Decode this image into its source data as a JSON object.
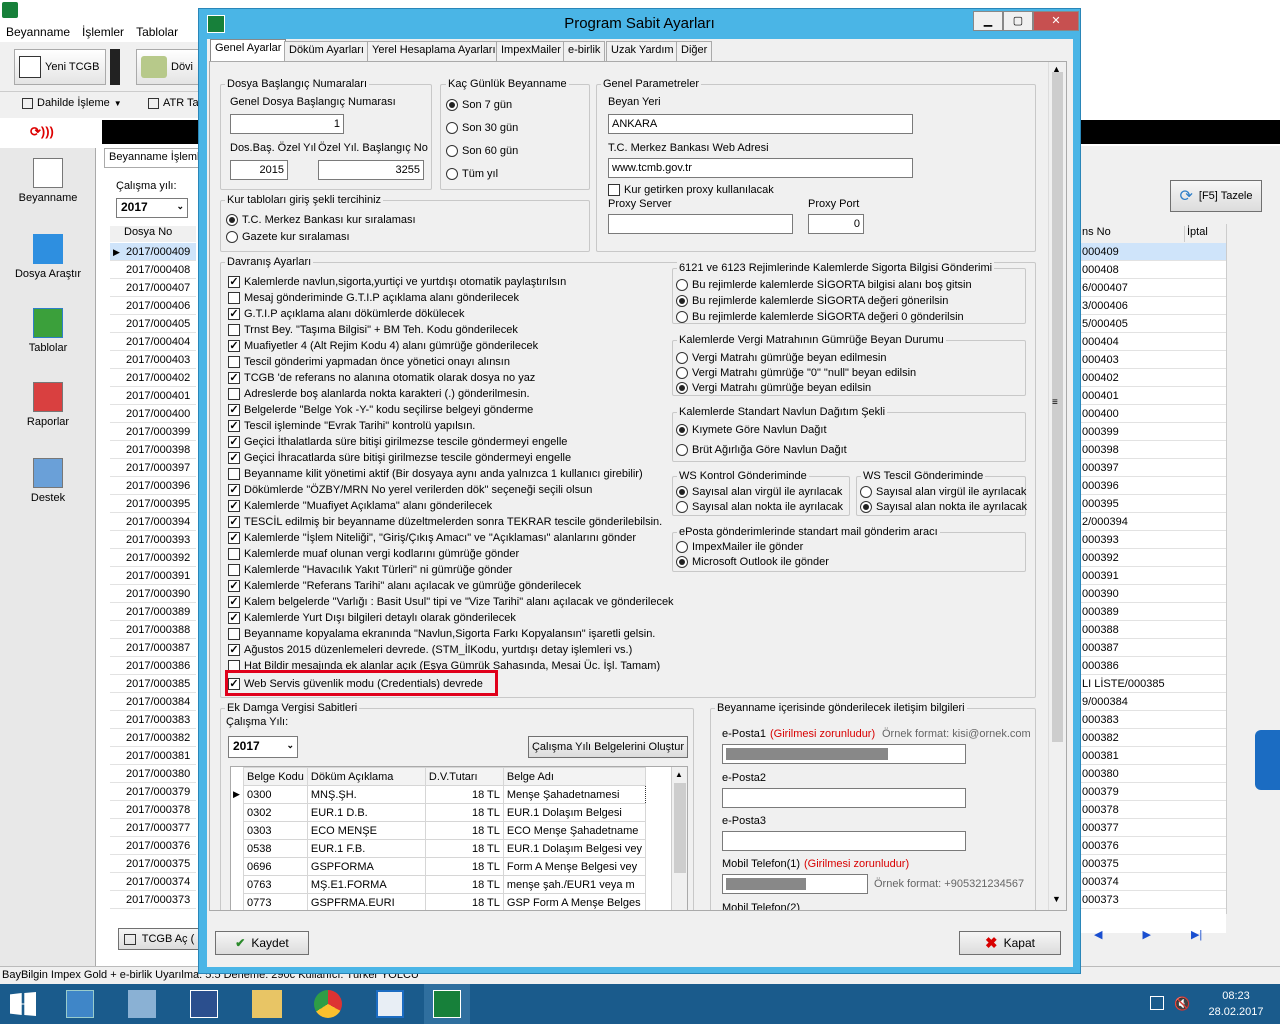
{
  "bg": {
    "menu": [
      "Beyanname",
      "İşlemler",
      "Tablolar"
    ],
    "toolbar": {
      "new_tcgb": "Yeni TCGB",
      "dovi": "Dövi",
      "dahilde": "Dahilde İşleme",
      "atr": "ATR Ta"
    },
    "nav": [
      "Beyanname",
      "Dosya Araştır",
      "Tablolar",
      "Raporlar",
      "Destek"
    ],
    "tab": "Beyanname İşleml",
    "year_label": "Çalışma yılı:",
    "year": "2017",
    "col_dosya": "Dosya No",
    "rows": [
      "2017/000409",
      "2017/000408",
      "2017/000407",
      "2017/000406",
      "2017/000405",
      "2017/000404",
      "2017/000403",
      "2017/000402",
      "2017/000401",
      "2017/000400",
      "2017/000399",
      "2017/000398",
      "2017/000397",
      "2017/000396",
      "2017/000395",
      "2017/000394",
      "2017/000393",
      "2017/000392",
      "2017/000391",
      "2017/000390",
      "2017/000389",
      "2017/000388",
      "2017/000387",
      "2017/000386",
      "2017/000385",
      "2017/000384",
      "2017/000383",
      "2017/000382",
      "2017/000381",
      "2017/000380",
      "2017/000379",
      "2017/000378",
      "2017/000377",
      "2017/000376",
      "2017/000375",
      "2017/000374",
      "2017/000373"
    ],
    "refresh": "[F5] Tazele",
    "right_col1": "ns No",
    "right_col2": "İptal",
    "right_rows": [
      "000409",
      "000408",
      "6/000407",
      "3/000406",
      "5/000405",
      "000404",
      "000403",
      "000402",
      "000401",
      "000400",
      "000399",
      "000398",
      "000397",
      "000396",
      "000395",
      "2/000394",
      "000393",
      "000392",
      "000391",
      "000390",
      "000389",
      "000388",
      "000387",
      "000386",
      "LI LİSTE/000385",
      "9/000384",
      "000383",
      "000382",
      "000381",
      "000380",
      "000379",
      "000378",
      "000377",
      "000376",
      "000375",
      "000374",
      "000373"
    ],
    "tcgb_ac": "TCGB Aç (",
    "status": "BayBilgin Impex Gold + e-birlik  Uyarılma: 5.5  Deneme: 290c           Kullanıcı: Türker YOLCU",
    "clock_time": "08:23",
    "clock_date": "28.02.2017"
  },
  "dialog": {
    "title": "Program Sabit Ayarları",
    "tabs": [
      "Genel Ayarlar",
      "Döküm Ayarları",
      "Yerel Hesaplama Ayarları",
      "ImpexMailer",
      "e-birlik",
      "Uzak Yardım",
      "Diğer"
    ],
    "dosya": {
      "legend": "Dosya Başlangıç Numaraları",
      "genel_label": "Genel Dosya Başlangıç Numarası",
      "genel_value": "1",
      "ozel_yil_label": "Dos.Baş. Özel Yıl",
      "ozel_baslangic_label": "Özel Yıl. Başlangıç No",
      "ozel_yil_value": "2015",
      "ozel_baslangic_value": "3255"
    },
    "kac_gun": {
      "legend": "Kaç Günlük Beyanname",
      "options": [
        "Son 7 gün",
        "Son 30 gün",
        "Son 60 gün",
        "Tüm yıl"
      ]
    },
    "genel": {
      "legend": "Genel Parametreler",
      "beyan_yeri_label": "Beyan Yeri",
      "beyan_yeri": "ANKARA",
      "tcmb_label": "T.C. Merkez Bankası Web Adresi",
      "tcmb": "www.tcmb.gov.tr",
      "proxy_cb": "Kur getirken proxy kullanılacak",
      "proxy_server_label": "Proxy Server",
      "proxy_port_label": "Proxy Port",
      "proxy_port": "0"
    },
    "kur": {
      "legend": "Kur tabloları giriş şekli tercihiniz",
      "options": [
        "T.C. Merkez Bankası kur sıralaması",
        "Gazete kur sıralaması"
      ]
    },
    "davranis": {
      "legend": "Davranış Ayarları",
      "items": [
        "Kalemlerde navlun,sigorta,yurtiçi ve yurtdışı otomatik paylaştırılsın",
        "Mesaj gönderiminde G.T.I.P açıklama alanı gönderilecek",
        "G.T.I.P açıklama alanı dökümlerde dökülecek",
        "Trnst Bey. \"Taşıma Bilgisi\" + BM Teh. Kodu gönderilecek",
        "Muafiyetler 4 (Alt Rejim Kodu 4) alanı gümrüğe gönderilecek",
        "Tescil gönderimi yapmadan önce yönetici onayı alınsın",
        "TCGB 'de referans no alanına otomatik olarak dosya no yaz",
        "Adreslerde boş alanlarda nokta karakteri (.) gönderilmesin.",
        "Belgelerde \"Belge Yok -Y-\" kodu seçilirse belgeyi gönderme",
        "Tescil işleminde \"Evrak Tarihi\" kontrolü yapılsın.",
        "Geçici İthalatlarda süre bitişi girilmezse tescile göndermeyi engelle",
        "Geçici İhracatlarda süre bitişi girilmezse tescile göndermeyi engelle",
        "Beyanname kilit yönetimi aktif (Bir dosyaya aynı anda yalnızca 1 kullanıcı girebilir)",
        "Dökümlerde \"ÖZBY/MRN No yerel verilerden dök\" seçeneği  seçili olsun",
        "Kalemlerde \"Muafiyet Açıklama\" alanı gönderilecek",
        "TESCİL edilmiş bir beyanname düzeltmelerden sonra TEKRAR tescile gönderilebilsin.",
        "Kalemlerde \"İşlem Niteliği\", \"Giriş/Çıkış Amacı\" ve \"Açıklaması\" alanlarını gönder",
        "Kalemlerde muaf olunan vergi kodlarını gümrüğe gönder",
        "Kalemlerde \"Havacılık Yakıt Türleri\" ni gümrüğe gönder",
        "Kalemlerde \"Referans Tarihi\" alanı açılacak ve gümrüğe gönderilecek",
        "Kalem belgelerde \"Varlığı : Basit Usul\" tipi ve \"Vize Tarihi\" alanı açılacak ve gönderilecek",
        "Kalemlerde Yurt Dışı bilgileri detaylı olarak gönderilecek",
        "Beyanname kopyalama ekranında \"Navlun,Sigorta Farkı Kopyalansın\" işaretli gelsin.",
        "Ağustos 2015 düzenlemeleri devrede. (STM_İlKodu, yurtdışı detay işlemleri vs.)",
        "Hat Bildir mesajında ek alanlar açık (Eşya Gümrük Sahasında, Mesai Üc. İşl. Tamam)",
        "Web Servis güvenlik modu (Credentials) devrede"
      ]
    },
    "sigorta": {
      "legend": "6121 ve 6123 Rejimlerinde Kalemlerde Sigorta Bilgisi Gönderimi",
      "options": [
        "Bu rejimlerde kalemlerde SİGORTA bilgisi alanı boş gitsin",
        "Bu rejimlerde kalemlerde SİGORTA değeri gönerilsin",
        "Bu rejimlerde kalemlerde SİGORTA değeri 0 gönderilsin"
      ]
    },
    "matrah": {
      "legend": "Kalemlerde Vergi Matrahının Gümrüğe Beyan Durumu",
      "options": [
        "Vergi Matrahı gümrüğe beyan edilmesin",
        "Vergi Matrahı gümrüğe \"0\" \"null\" beyan edilsin",
        "Vergi Matrahı gümrüğe beyan edilsin"
      ]
    },
    "navlun": {
      "legend": "Kalemlerde Standart Navlun Dağıtım Şekli",
      "options": [
        "Kıymete Göre Navlun Dağıt",
        "Brüt Ağırlığa Göre Navlun Dağıt"
      ]
    },
    "ws_kontrol": {
      "legend": "WS Kontrol Gönderiminde",
      "options": [
        "Sayısal alan virgül ile ayrılacak",
        "Sayısal alan nokta ile ayrılacak"
      ]
    },
    "ws_tescil": {
      "legend": "WS Tescil Gönderiminde",
      "options": [
        "Sayısal alan virgül ile ayrılacak",
        "Sayısal alan nokta ile ayrılacak"
      ]
    },
    "eposta": {
      "legend": "ePosta gönderimlerinde standart mail gönderim aracı",
      "options": [
        "ImpexMailer ile gönder",
        "Microsoft Outlook ile gönder"
      ]
    },
    "damga": {
      "legend": "Ek Damga Vergisi Sabitleri",
      "year_label": "Çalışma Yılı:",
      "year": "2017",
      "create_btn": "Çalışma Yılı Belgelerini Oluştur",
      "headers": [
        "Belge Kodu",
        "Döküm Açıklama",
        "D.V.Tutarı",
        "Belge Adı"
      ],
      "rows": [
        [
          "0300",
          "MNŞ.ŞH.",
          "18 TL",
          "Menşe Şahadetnamesi"
        ],
        [
          "0302",
          "EUR.1 D.B.",
          "18 TL",
          "EUR.1 Dolaşım Belgesi"
        ],
        [
          "0303",
          "ECO MENŞE",
          "18 TL",
          "ECO Menşe Şahadetname"
        ],
        [
          "0538",
          "EUR.1 F.B.",
          "18 TL",
          "EUR.1 Dolaşım Belgesi vey"
        ],
        [
          "0696",
          "GSPFORMA",
          "18 TL",
          "Form A Menşe Belgesi vey"
        ],
        [
          "0763",
          "MŞ.E1.FORMA",
          "18 TL",
          "menşe şah./EUR1 veya m"
        ],
        [
          "0773",
          "GSPFRMA.EURI",
          "18 TL",
          "GSP Form A Menşe Belges"
        ]
      ]
    },
    "iletisim": {
      "legend": "Beyanname içerisinde gönderilecek iletişim bilgileri",
      "eposta1": "e-Posta1",
      "required": "(Girilmesi zorunludur)",
      "ornek_mail": "Örnek format: kisi@ornek.com",
      "eposta2": "e-Posta2",
      "eposta3": "e-Posta3",
      "mobil1": "Mobil Telefon(1)",
      "ornek_tel": "Örnek format: +905321234567",
      "mobil2": "Mobil Telefon(2)"
    },
    "save": "Kaydet",
    "close": "Kapat"
  },
  "colors": {
    "dialog_frame": "#4ab5e6",
    "highlight": "#e0001b",
    "accent_red": "#d80000"
  }
}
